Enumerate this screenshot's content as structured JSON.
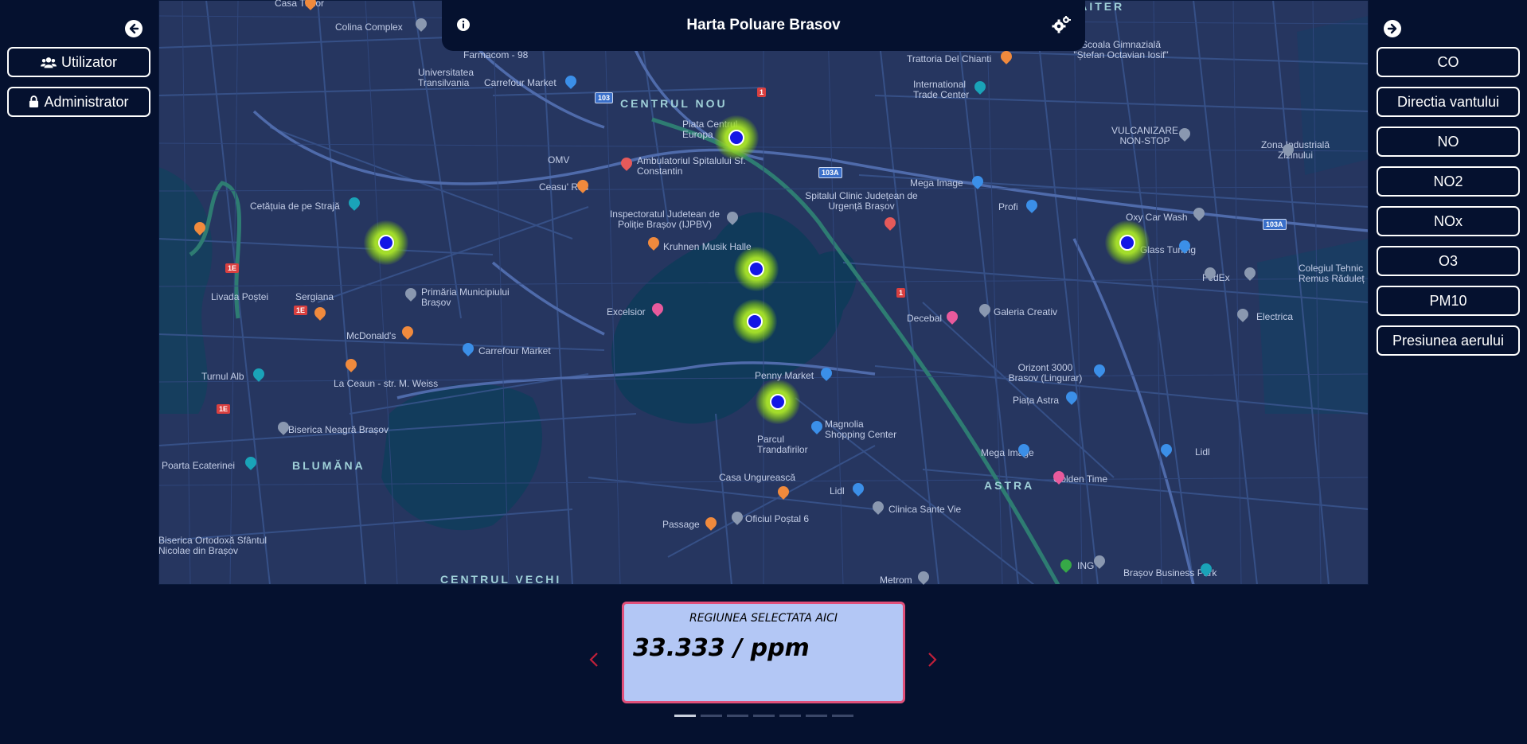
{
  "header": {
    "title": "Harta Poluare Brasov"
  },
  "left_menu": {
    "items": [
      {
        "label": "Utilizator",
        "icon": "users-icon"
      },
      {
        "label": "Administrator",
        "icon": "lock-icon"
      }
    ]
  },
  "right_menu": {
    "items": [
      {
        "label": "CO"
      },
      {
        "label": "Directia vantului"
      },
      {
        "label": "NO"
      },
      {
        "label": "NO2"
      },
      {
        "label": "NOx"
      },
      {
        "label": "O3"
      },
      {
        "label": "PM10"
      },
      {
        "label": "Presiunea aerului"
      }
    ]
  },
  "map": {
    "districts": [
      "CENTRUL NOU",
      "BLUMĂNA",
      "ASTRA",
      "CENTRUL VECHI",
      "CRAITER"
    ],
    "labels": [
      "Casa Tudor",
      "Colina Complex",
      "Farmacom - 98",
      "Universitatea Transilvania",
      "Carrefour Market",
      "Piata Centrul Europa",
      "Ambulatoriul Spitalului Sf. Constantin",
      "OMV",
      "Ceasu' Rău",
      "Cetățuia de pe Strajă",
      "Inspectoratul Judetean de Poliție Brașov (IJPBV)",
      "Kruhnen Musik Halle",
      "Sergiana",
      "Primăria Municipiului Brașov",
      "McDonald's",
      "Carrefour Market",
      "Excelsior",
      "La Ceaun - str. M. Weiss",
      "Turnul Alb",
      "Biserica Neagră Brașov",
      "Poarta Ecaterinei",
      "Penny Market",
      "Magnolia Shopping Center",
      "Parcul Trandafirilor",
      "Casa Ungurească",
      "Passage",
      "Oficiul Poștal 6",
      "Lidl",
      "Clinica Sante Vie",
      "Metrom",
      "Trattoria Del Chianti",
      "International Trade Center",
      "Mega Image",
      "Spitalul Clinic Județean de Urgență Brașov",
      "Profi",
      "Decebal",
      "Galeria Creativ",
      "Orizont 3000 Brasov (Lingurar)",
      "Piața Astra",
      "Mega Image",
      "Golden Time",
      "Scoala Gimnazială \"Ștefan Octavian Iosif\"",
      "VULCANIZARE NON-STOP",
      "Zona Industrială Zizinului",
      "Oxy Car Wash",
      "Glass Tuning",
      "FedEx",
      "Colegiul Tehnic Remus Răduleț",
      "Electrica",
      "Lidl",
      "ING",
      "Brașov Business Park",
      "Livada Poștei",
      "Biserica Ortodoxă Sfântul Nicolae din Brașov"
    ],
    "road_badges": [
      "103",
      "1",
      "103A",
      "1E",
      "1E",
      "1E",
      "103A",
      "1"
    ]
  },
  "carousel": {
    "label": "REGIUNEA SELECTATA AICI",
    "value": "33.333 / ppm",
    "slide_count": 7,
    "active_slide": 1
  },
  "colors": {
    "background": "#05112f",
    "card_bg": "#b3c7f5",
    "card_border": "#e0507a",
    "sensor_dot": "#1316e6",
    "sensor_glow": "#aae628",
    "arrow_red": "#c0203a"
  }
}
